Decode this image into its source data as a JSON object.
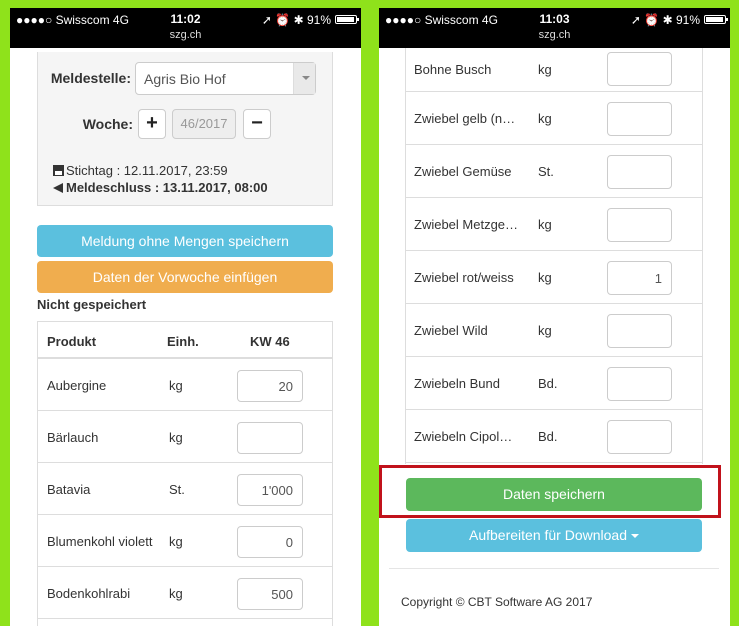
{
  "left_phone": {
    "status": {
      "carrier": "●●●●○ Swisscom  4G",
      "time": "11:02",
      "url": "szg.ch",
      "right": "➚ ⏰ ✱ 91%"
    },
    "form": {
      "meldestelle_label": "Meldestelle:",
      "meldestelle_value": "Agris Bio Hof",
      "woche_label": "Woche:",
      "woche_value": "46/2017",
      "plus": "+",
      "minus": "−",
      "stichtag": "Stichtag : 12.11.2017, 23:59",
      "meldeschluss": "Meldeschluss : 13.11.2017, 08:00"
    },
    "buttons": {
      "no_qty": "Meldung ohne Mengen speichern",
      "prev_week": "Daten der Vorwoche einfügen"
    },
    "unsaved_text": "Nicht gespeichert",
    "table": {
      "headers": [
        "Produkt",
        "Einh.",
        "KW 46"
      ],
      "rows": [
        {
          "product": "Aubergine",
          "unit": "kg",
          "qty": "20"
        },
        {
          "product": "Bärlauch",
          "unit": "kg",
          "qty": ""
        },
        {
          "product": "Batavia",
          "unit": "St.",
          "qty": "1'000"
        },
        {
          "product": "Blumenkohl violett",
          "unit": "kg",
          "qty": "0"
        },
        {
          "product": "Bodenkohlrabi",
          "unit": "kg",
          "qty": "500"
        }
      ]
    }
  },
  "right_phone": {
    "status": {
      "carrier": "●●●●○ Swisscom  4G",
      "time": "11:03",
      "url": "szg.ch",
      "right": "➚ ⏰ ✱ 91%"
    },
    "table": {
      "rows": [
        {
          "product": "Bohne Busch",
          "unit": "kg",
          "qty": ""
        },
        {
          "product": "Zwiebel gelb (n…",
          "unit": "kg",
          "qty": ""
        },
        {
          "product": "Zwiebel Gemüse",
          "unit": "St.",
          "qty": ""
        },
        {
          "product": "Zwiebel Metzge…",
          "unit": "kg",
          "qty": ""
        },
        {
          "product": "Zwiebel rot/weiss",
          "unit": "kg",
          "qty": "1"
        },
        {
          "product": "Zwiebel Wild",
          "unit": "kg",
          "qty": ""
        },
        {
          "product": "Zwiebeln Bund",
          "unit": "Bd.",
          "qty": ""
        },
        {
          "product": "Zwiebeln Cipol…",
          "unit": "Bd.",
          "qty": ""
        }
      ]
    },
    "buttons": {
      "save": "Daten speichern",
      "download": "Aufbereiten für Download"
    },
    "copyright": "Copyright © CBT Software AG 2017"
  },
  "colors": {
    "background": "#8fe21b",
    "info": "#5bc0de",
    "warning": "#f0ad4e",
    "success": "#5cb85c",
    "highlight": "#c1121b"
  },
  "battery_level": 0.91
}
